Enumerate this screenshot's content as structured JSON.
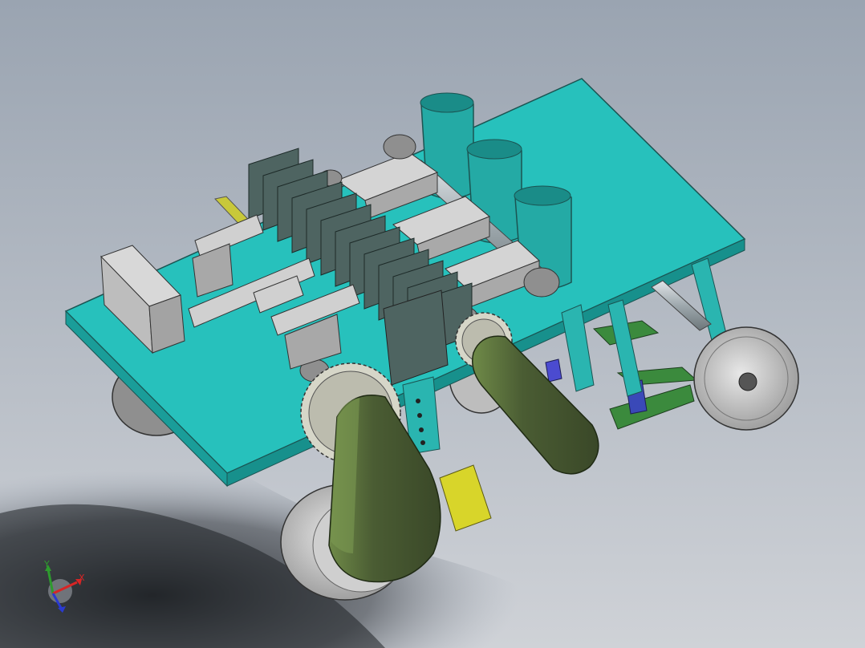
{
  "viewport": {
    "background_top": "#9aa4b1",
    "background_bottom": "#c9cdd3",
    "shadow_color": "#1f2226"
  },
  "model": {
    "name": "seeder-assembly",
    "colors": {
      "deck": "#27c1bc",
      "deck_edge": "#1a9d99",
      "frame": "#2ab5b0",
      "hopper": "#24aaa5",
      "block": "#c2c2c2",
      "fins": "#4e6461",
      "shaft": "#a9b2b6",
      "sprocket": "#d6d6c8",
      "chain_guard": "#4a5c33",
      "chain_guard_highlight": "#6f8a48",
      "wheel": "#d9d9d9",
      "yellow_part": "#d8d52a",
      "blade": "#3b8a3d",
      "rail": "#c8c83a"
    }
  },
  "triad": {
    "y_label": "Y",
    "x_label": "X",
    "y_color": "#2e9b2e",
    "x_color": "#d82525",
    "z_color": "#2a3ad0"
  }
}
